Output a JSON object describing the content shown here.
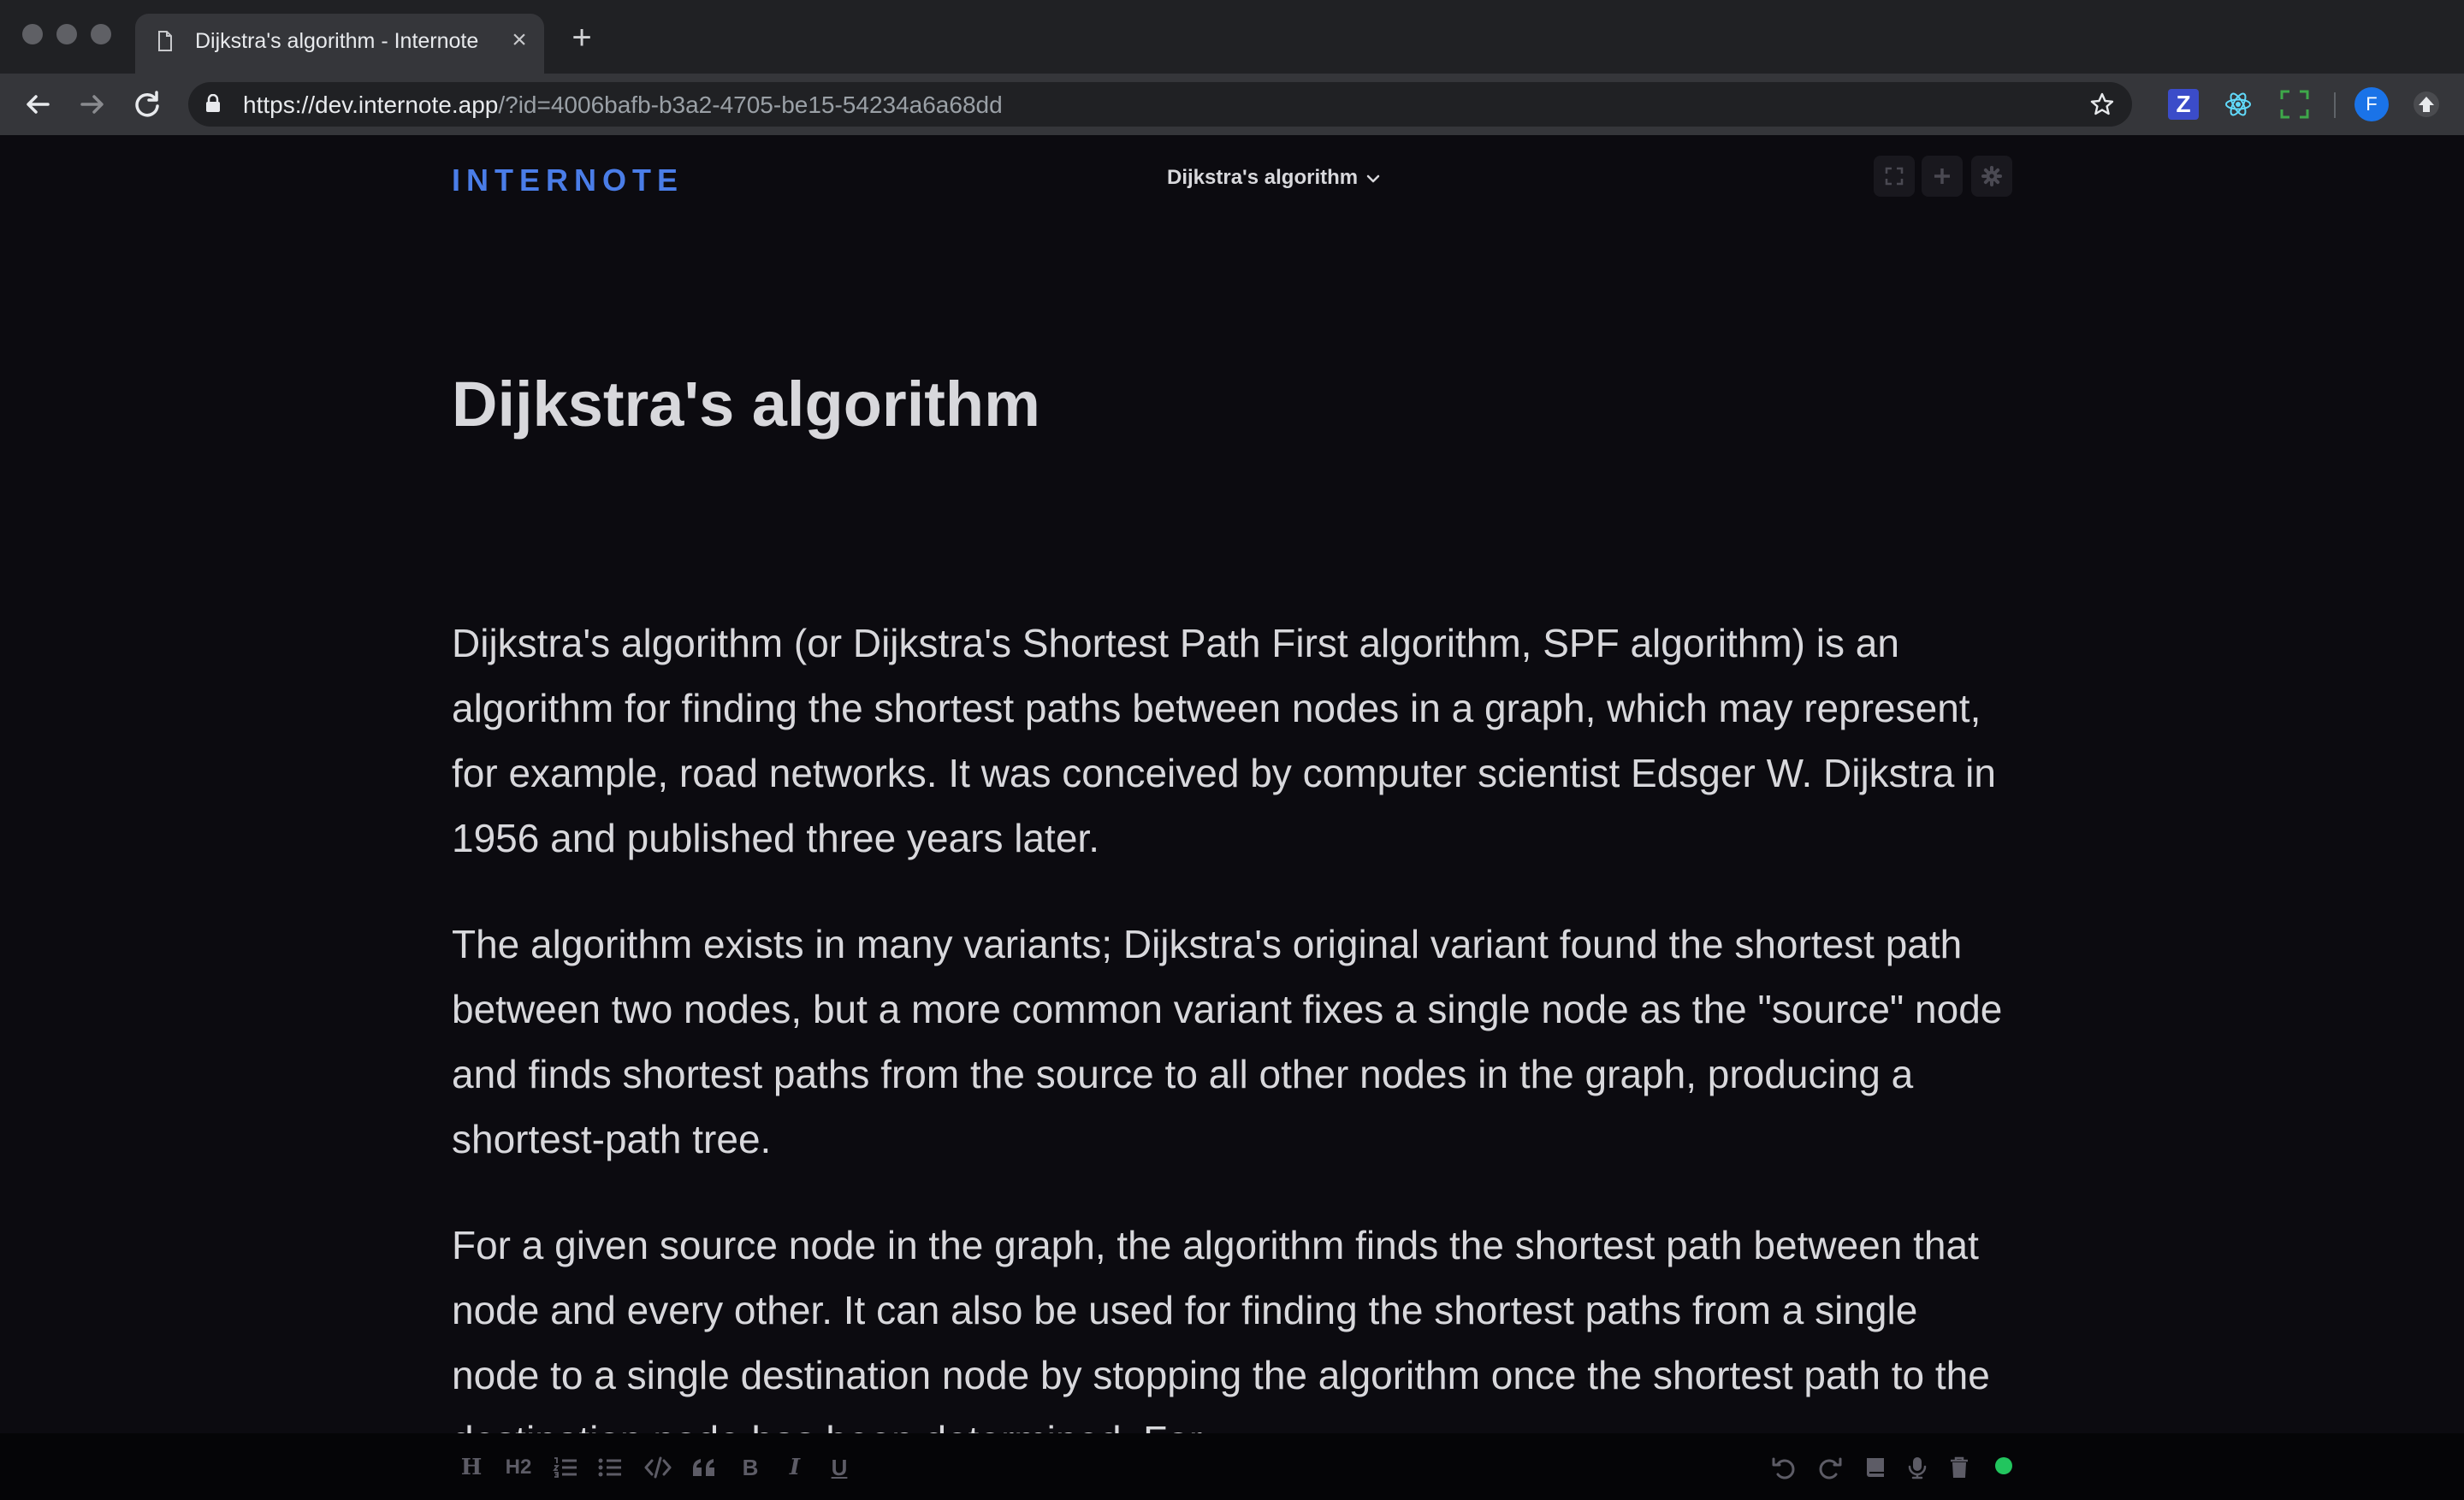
{
  "browser": {
    "tab_title": "Dijkstra's algorithm - Internote",
    "url_host": "https://dev.internote.app",
    "url_path": "/?id=4006bafb-b3a2-4705-be15-54234a6a68dd",
    "extension_z_label": "Z",
    "avatar_initial": "F",
    "colors": {
      "frame": "#202124",
      "toolbar": "#35363a",
      "avatar": "#1a73e8"
    }
  },
  "app": {
    "logo": "INTERNOTE",
    "note_selector": "Dijkstra's algorithm",
    "header_icons": [
      "fullscreen-icon",
      "plus-icon",
      "gear-icon"
    ],
    "colors": {
      "background": "#0c0b10",
      "accent": "#4a7de8",
      "status": "#22c55e"
    }
  },
  "document": {
    "title": "Dijkstra's algorithm",
    "paragraphs": [
      "Dijkstra's algorithm (or Dijkstra's Shortest Path First algorithm, SPF algorithm) is an algorithm for finding the shortest paths between nodes in a graph, which may represent, for example, road networks. It was conceived by computer scientist Edsger W. Dijkstra in 1956 and published three years later.",
      "The algorithm exists in many variants; Dijkstra's original variant found the shortest path between two nodes, but a more common variant fixes a single node as the \"source\" node and finds shortest paths from the source to all other nodes in the graph, producing a shortest-path tree.",
      "For a given source node in the graph, the algorithm finds the shortest path between that node and every other. It can also be used for finding the shortest paths from a single node to a single destination node by stopping the algorithm once the shortest path to the destination node has been determined. For"
    ]
  },
  "bottom_toolbar": {
    "heading_label": "H",
    "heading2_label": "H2",
    "bold_label": "B",
    "italic_label": "I",
    "underline_label": "U",
    "format_icons": [
      "ordered-list-icon",
      "bullet-list-icon",
      "code-icon",
      "quote-icon"
    ],
    "action_icons": [
      "undo-icon",
      "redo-icon",
      "book-icon",
      "microphone-icon",
      "trash-icon"
    ],
    "status": "connected"
  }
}
